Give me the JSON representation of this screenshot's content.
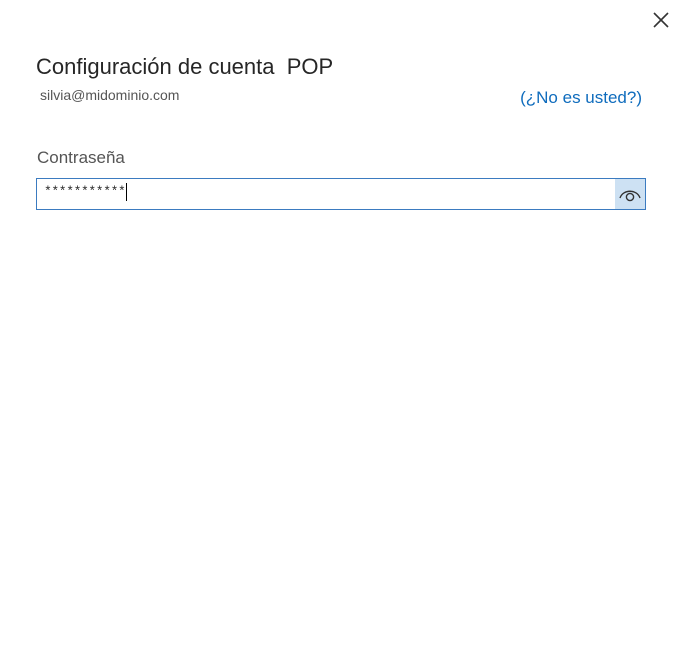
{
  "dialog": {
    "title": "Configuración de cuenta  POP",
    "email": "silvia@midominio.com",
    "not_you_link": "(¿No es usted?)",
    "close_icon": "close-icon"
  },
  "password": {
    "label": "Contraseña",
    "masked_value": "***********",
    "reveal_icon": "eye-icon"
  },
  "colors": {
    "link": "#0f6cbd",
    "field_border": "#3b7bc0",
    "reveal_bg": "#cde1f3"
  }
}
